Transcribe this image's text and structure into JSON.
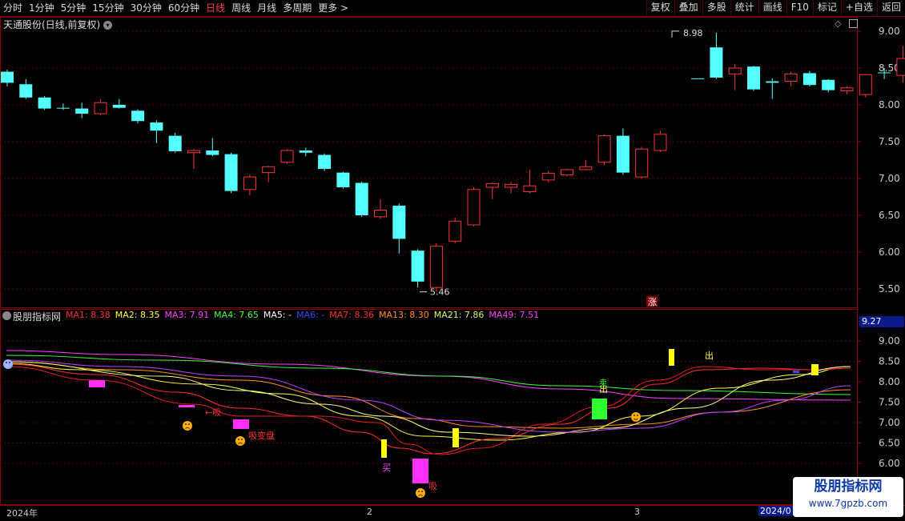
{
  "toolbar": {
    "periods": [
      "分时",
      "1分钟",
      "5分钟",
      "15分钟",
      "30分钟",
      "60分钟",
      "日线",
      "周线",
      "月线",
      "多周期",
      "更多 >"
    ],
    "active_period": "日线",
    "buttons": [
      "复权",
      "叠加",
      "多股",
      "统计",
      "画线",
      "F10",
      "标记",
      "+自选",
      "返回"
    ]
  },
  "stock": {
    "title": "天通股份(日线,前复权)"
  },
  "main_axis": {
    "labels": [
      "9.00",
      "8.50",
      "8.00",
      "7.50",
      "7.00",
      "6.50",
      "6.00",
      "5.50"
    ]
  },
  "annotations": {
    "high_label": "8.98",
    "low_label": "5.46",
    "zhang": "涨"
  },
  "indicator": {
    "name": "股朋指标网",
    "ma": [
      {
        "label": "MA1: 8.38",
        "color": "#ff3030"
      },
      {
        "label": "MA2: 8.35",
        "color": "#ffff40"
      },
      {
        "label": "MA3: 7.91",
        "color": "#ff40ff"
      },
      {
        "label": "MA4: 7.65",
        "color": "#40ff40"
      },
      {
        "label": "MA5: -",
        "color": "#ffffff"
      },
      {
        "label": "MA6: -",
        "color": "#3050ff"
      },
      {
        "label": "MA7: 8.36",
        "color": "#ff3030"
      },
      {
        "label": "MA13: 8.30",
        "color": "#ff9020"
      },
      {
        "label": "MA21: 7.86",
        "color": "#d0ff60"
      },
      {
        "label": "MA49: 7.51",
        "color": "#ff40ff"
      }
    ],
    "current_value": "9.27",
    "axis": {
      "labels": [
        "9.00",
        "8.50",
        "8.00",
        "7.50",
        "7.00",
        "6.50",
        "6.00"
      ]
    },
    "signals": {
      "buy": "买",
      "sell": "出",
      "sell2": "出",
      "xi": "吸",
      "xi2": "吸",
      "xi_bian": "吸变盘",
      "mai": "卖"
    }
  },
  "dates": {
    "start": "2024年",
    "m2": "2",
    "m3": "3",
    "end": "2024/0"
  },
  "watermark": {
    "title": "股朋指标网",
    "url": "www.7gpzb.com"
  },
  "chart_data": {
    "type": "candlestick",
    "title": "天通股份(日线,前复权)",
    "ylim": [
      5.3,
      9.15
    ],
    "candles": [
      {
        "o": 8.45,
        "c": 8.3,
        "h": 8.48,
        "l": 8.25
      },
      {
        "o": 8.28,
        "c": 8.1,
        "h": 8.35,
        "l": 8.08
      },
      {
        "o": 8.1,
        "c": 7.95,
        "h": 8.12,
        "l": 7.93
      },
      {
        "o": 7.96,
        "c": 7.96,
        "h": 8.02,
        "l": 7.93
      },
      {
        "o": 7.95,
        "c": 7.88,
        "h": 8.03,
        "l": 7.82
      },
      {
        "o": 7.88,
        "c": 8.03,
        "h": 8.08,
        "l": 7.86
      },
      {
        "o": 8.0,
        "c": 7.96,
        "h": 8.08,
        "l": 7.95
      },
      {
        "o": 7.92,
        "c": 7.78,
        "h": 7.94,
        "l": 7.75
      },
      {
        "o": 7.76,
        "c": 7.65,
        "h": 7.79,
        "l": 7.48
      },
      {
        "o": 7.58,
        "c": 7.37,
        "h": 7.62,
        "l": 7.35
      },
      {
        "o": 7.35,
        "c": 7.38,
        "h": 7.4,
        "l": 7.13
      },
      {
        "o": 7.38,
        "c": 7.32,
        "h": 7.55,
        "l": 7.3
      },
      {
        "o": 7.33,
        "c": 6.83,
        "h": 7.35,
        "l": 6.8
      },
      {
        "o": 6.85,
        "c": 7.02,
        "h": 7.05,
        "l": 6.77
      },
      {
        "o": 7.08,
        "c": 7.16,
        "h": 7.17,
        "l": 6.95
      },
      {
        "o": 7.22,
        "c": 7.38,
        "h": 7.4,
        "l": 7.2
      },
      {
        "o": 7.38,
        "c": 7.35,
        "h": 7.42,
        "l": 7.3
      },
      {
        "o": 7.32,
        "c": 7.13,
        "h": 7.34,
        "l": 7.1
      },
      {
        "o": 7.08,
        "c": 6.88,
        "h": 7.09,
        "l": 6.86
      },
      {
        "o": 6.94,
        "c": 6.5,
        "h": 6.96,
        "l": 6.48
      },
      {
        "o": 6.48,
        "c": 6.57,
        "h": 6.72,
        "l": 6.45
      },
      {
        "o": 6.63,
        "c": 6.18,
        "h": 6.66,
        "l": 5.98
      },
      {
        "o": 6.02,
        "c": 5.6,
        "h": 6.04,
        "l": 5.52
      },
      {
        "o": 5.52,
        "c": 6.08,
        "h": 6.12,
        "l": 5.46
      },
      {
        "o": 6.15,
        "c": 6.42,
        "h": 6.47,
        "l": 6.12
      },
      {
        "o": 6.37,
        "c": 6.85,
        "h": 6.88,
        "l": 6.35
      },
      {
        "o": 6.88,
        "c": 6.93,
        "h": 6.95,
        "l": 6.72
      },
      {
        "o": 6.88,
        "c": 6.92,
        "h": 6.95,
        "l": 6.8
      },
      {
        "o": 6.82,
        "c": 6.9,
        "h": 7.12,
        "l": 6.8
      },
      {
        "o": 6.98,
        "c": 7.07,
        "h": 7.1,
        "l": 6.95
      },
      {
        "o": 7.05,
        "c": 7.12,
        "h": 7.13,
        "l": 7.03
      },
      {
        "o": 7.12,
        "c": 7.16,
        "h": 7.25,
        "l": 7.11
      },
      {
        "o": 7.22,
        "c": 7.58,
        "h": 7.6,
        "l": 7.18
      },
      {
        "o": 7.58,
        "c": 7.08,
        "h": 7.68,
        "l": 7.05
      },
      {
        "o": 7.02,
        "c": 7.4,
        "h": 7.43,
        "l": 7.0
      },
      {
        "o": 7.38,
        "c": 7.6,
        "h": 7.65,
        "l": 7.36
      },
      null,
      {
        "o": 8.36,
        "c": 8.36,
        "h": 8.36,
        "l": 8.36
      },
      {
        "o": 8.78,
        "c": 8.37,
        "h": 8.98,
        "l": 8.35
      },
      {
        "o": 8.42,
        "c": 8.5,
        "h": 8.55,
        "l": 8.2
      },
      {
        "o": 8.52,
        "c": 8.21,
        "h": 8.53,
        "l": 8.19
      },
      {
        "o": 8.32,
        "c": 8.3,
        "h": 8.36,
        "l": 8.08
      },
      {
        "o": 8.32,
        "c": 8.42,
        "h": 8.45,
        "l": 8.25
      },
      {
        "o": 8.43,
        "c": 8.27,
        "h": 8.46,
        "l": 8.25
      },
      {
        "o": 8.34,
        "c": 8.2,
        "h": 8.35,
        "l": 8.17
      },
      {
        "o": 8.19,
        "c": 8.23,
        "h": 8.25,
        "l": 8.14
      },
      {
        "o": 8.14,
        "c": 8.41,
        "h": 8.42,
        "l": 8.1
      },
      {
        "o": 8.44,
        "c": 8.43,
        "h": 8.5,
        "l": 8.35
      },
      {
        "o": 8.4,
        "c": 8.63,
        "h": 8.8,
        "l": 8.3
      }
    ]
  }
}
